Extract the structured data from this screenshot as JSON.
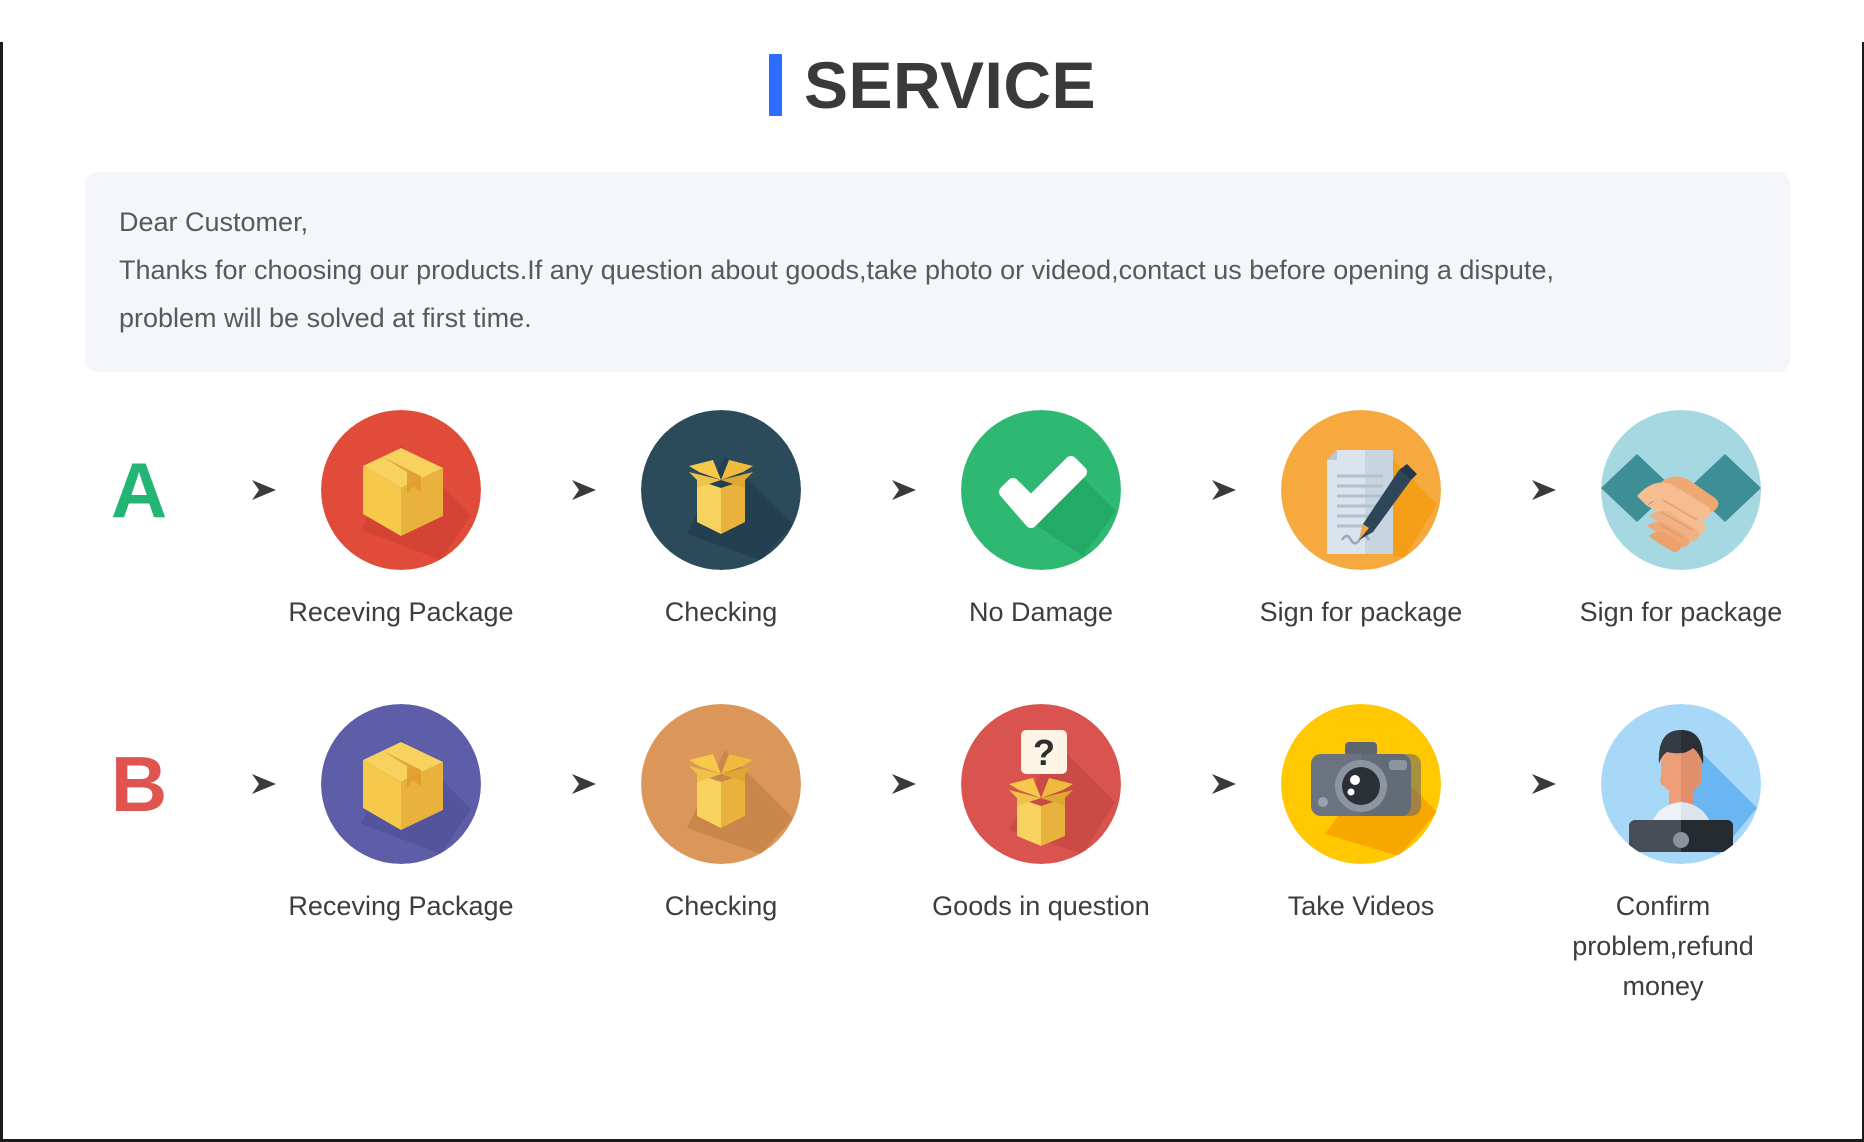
{
  "header": {
    "accent_color": "#2f6bff",
    "title": "SERVICE"
  },
  "notice": {
    "lines": [
      "Dear Customer,",
      "Thanks for choosing our products.If any question about goods,take photo or videod,contact us before opening a dispute,",
      "problem will be solved at first time."
    ]
  },
  "flows": [
    {
      "badge": "A",
      "badge_color": "#22b573",
      "steps": [
        {
          "label": "Receving Package",
          "icon": "closed-box-icon",
          "circle_color": "#e04b3a"
        },
        {
          "label": "Checking",
          "icon": "open-box-icon",
          "circle_color": "#2b4a5a"
        },
        {
          "label": "No Damage",
          "icon": "check-mark-icon",
          "circle_color": "#2eb872"
        },
        {
          "label": "Sign for package",
          "icon": "document-pen-icon",
          "circle_color": "#f5a93f"
        },
        {
          "label": "Sign for package",
          "icon": "handshake-icon",
          "circle_color": "#a5d8e0"
        }
      ]
    },
    {
      "badge": "B",
      "badge_color": "#e0544f",
      "steps": [
        {
          "label": "Receving Package",
          "icon": "closed-box-icon",
          "circle_color": "#5e5ea8"
        },
        {
          "label": "Checking",
          "icon": "open-box-icon",
          "circle_color": "#db9659"
        },
        {
          "label": "Goods in question",
          "icon": "question-box-icon",
          "circle_color": "#d9534f"
        },
        {
          "label": "Take Videos",
          "icon": "camera-icon",
          "circle_color": "#ffc800"
        },
        {
          "label": "Confirm problem,refund money",
          "icon": "support-person-icon",
          "circle_color": "#a8d8f8"
        }
      ]
    }
  ],
  "arrow": {
    "name": "arrow-right-icon",
    "color": "#4a4a4a"
  }
}
